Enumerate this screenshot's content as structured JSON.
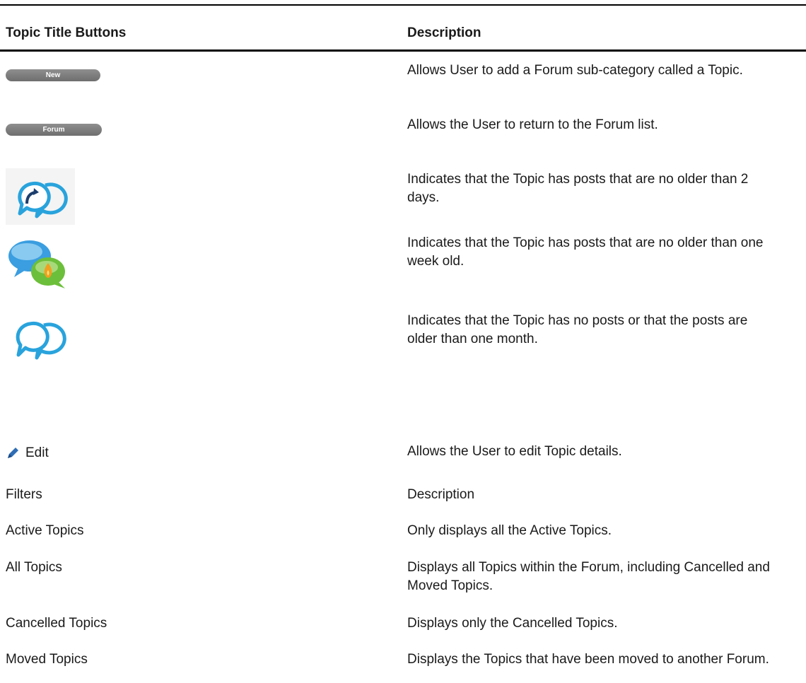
{
  "table": {
    "header": {
      "col1": "Topic Title Buttons",
      "col2": "Description"
    },
    "rows": [
      {
        "label": "New",
        "description": "Allows User to add a Forum sub-category called a Topic."
      },
      {
        "label": "Forum",
        "description": "Allows the User to return to the Forum list."
      },
      {
        "icon": "reply-bubbles-icon",
        "description": "Indicates that the Topic has posts that are no older than 2 days."
      },
      {
        "icon": "hot-bubbles-icon",
        "description": "Indicates that the Topic has posts that are no older than one week old."
      },
      {
        "icon": "empty-bubbles-icon",
        "description": "Indicates that the Topic has no posts or that the posts are older than one month."
      },
      {
        "label": "Edit",
        "icon": "pencil-icon",
        "description": "Allows the User to edit Topic details."
      }
    ]
  },
  "filters": {
    "header": {
      "col1": "Filters",
      "col2": "Description"
    },
    "rows": [
      {
        "label": "Active Topics",
        "description": "Only displays all the Active Topics."
      },
      {
        "label": "All Topics",
        "description": "Displays all Topics within the Forum, including Cancelled and Moved Topics."
      },
      {
        "label": "Cancelled Topics",
        "description": "Displays only the Cancelled Topics."
      },
      {
        "label": "Moved Topics",
        "description": "Displays the Topics that have been moved to another Forum."
      }
    ]
  },
  "colors": {
    "rule": "#000000",
    "button": "#7a7a7a",
    "bubble_blue": "#29a3dc",
    "bubble_green": "#6cbf3a",
    "flame": "#f0a020",
    "pencil": "#2f6db5"
  }
}
